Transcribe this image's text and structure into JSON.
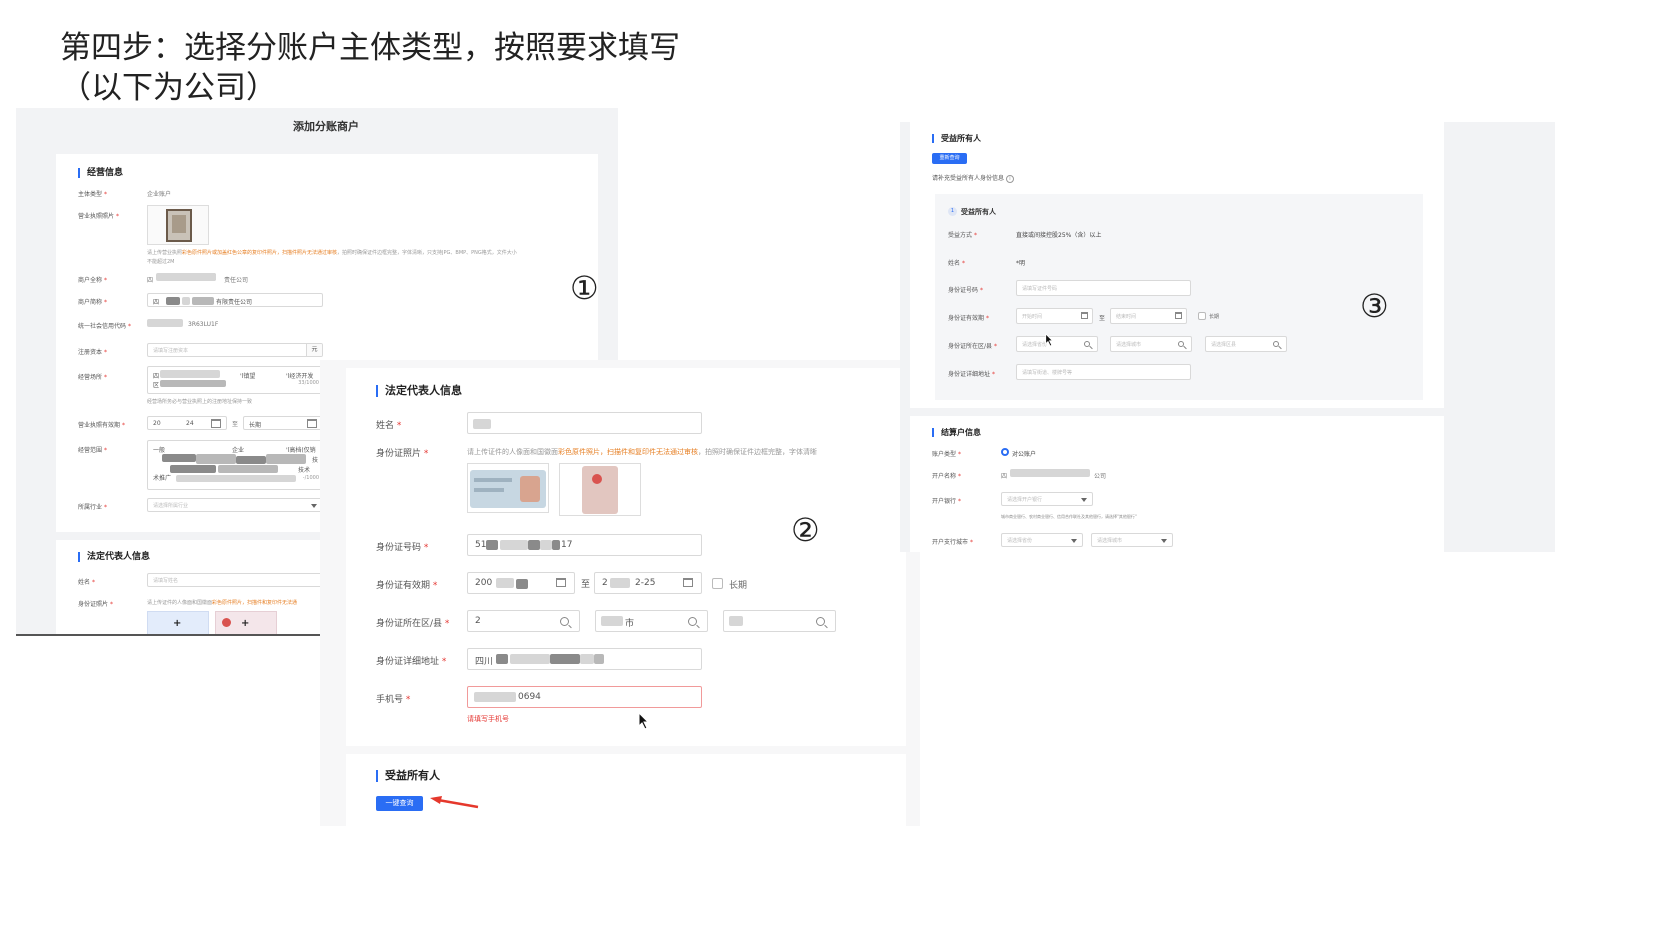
{
  "slide": {
    "title_line1": "第四步：选择分账户主体类型，按照要求填写",
    "title_line2": "（以下为公司）"
  },
  "markers": {
    "one": "①",
    "two": "②",
    "three": "③"
  },
  "panel1": {
    "header": "添加分账商户",
    "section_business": "经营信息",
    "subject_type_label": "主体类型",
    "subject_type_value": "企业账户",
    "license_photo_label": "营业执照照片",
    "license_note_a": "请上传营业执照",
    "license_note_b": "彩色原件照片或加盖红色公章的复印件照片，扫描件照片无法通过审核",
    "license_note_c": "，拍照时确保证件边框完整，字体清晰，只支持JPG、BMP、PNG格式，文件大小",
    "license_note_d": "不能超过2M",
    "full_name_label": "商户全称",
    "full_name_value_a": "四",
    "full_name_value_b": "责任公司",
    "short_name_label": "商户简称",
    "short_name_value_a": "四",
    "short_name_value_b": "有限责任公司",
    "credit_code_label": "统一社会信用代码",
    "credit_code_value": "3R63LU1F",
    "capital_label": "注册资本",
    "capital_placeholder": "请填写注册资本",
    "capital_unit": "元",
    "address_label": "经营场所",
    "address_value_a": "四",
    "address_value_b": "'l镇望",
    "address_value_c": "'l经济开发",
    "address_value_d": "区",
    "address_counter": "33/1000",
    "address_note": "经营场所务必与营业执照上的注册地址保持一致",
    "validity_label": "营业执照有效期",
    "validity_start_a": "20",
    "validity_start_b": "24",
    "validity_to": "至",
    "validity_end": "长期",
    "scope_label": "经营范围",
    "scope_line1_a": "一般",
    "scope_line1_b": "企业",
    "scope_line1_c": "'l高档(仅销",
    "scope_line3": "技",
    "scope_line4_a": "术推广",
    "scope_line4_b": "技术",
    "scope_line5": "-/1000",
    "industry_label": "所属行业",
    "industry_placeholder": "请选择所属行业",
    "section_legal": "法定代表人信息",
    "legal_name_label": "姓名",
    "legal_name_placeholder": "请填写姓名",
    "legal_id_photo_label": "身份证照片",
    "legal_id_note_a": "请上传证件的人像面和国徽面",
    "legal_id_note_b": "彩色原件照片，扫描件和复印件无法通",
    "plus_1": "+",
    "plus_2": "+"
  },
  "panel2": {
    "section_legal": "法定代表人信息",
    "name_label": "姓名",
    "id_photo_label": "身份证照片",
    "id_photo_note_a": "请上传证件的人像面和国徽面",
    "id_photo_note_b": "彩色原件照片，扫描件和复印件无法通过审核",
    "id_photo_note_c": "，拍照时确保证件边框完整，字体清晰",
    "id_number_label": "身份证号码",
    "id_number_a": "51",
    "id_number_b": "17",
    "id_validity_label": "身份证有效期",
    "id_validity_start": "200",
    "id_validity_to": "至",
    "id_validity_end_a": "2",
    "id_validity_end_b": "2-25",
    "long_term": "长期",
    "region_label": "身份证所在区/县",
    "region_1": "2",
    "region_2": "市",
    "address_label": "身份证详细地址",
    "address_value": "四川",
    "phone_label": "手机号",
    "phone_value": "0694",
    "phone_error": "请填写手机号",
    "section_beneficiary": "受益所有人",
    "query_button": "一键查询"
  },
  "panel3": {
    "section_beneficiary": "受益所有人",
    "requery_button": "重新查询",
    "supplement_note": "请补充受益所有人身份信息",
    "info_icon": "i",
    "beneficiary_index": "1",
    "beneficiary_title": "受益所有人",
    "benefit_method_label": "受益方式",
    "benefit_method_value": "直接或间接控股25%（含）以上",
    "name_label": "姓名",
    "name_value": "*明",
    "id_number_label": "身份证号码",
    "id_number_placeholder": "请填写证件号码",
    "id_validity_label": "身份证有效期",
    "start_placeholder": "开始时间",
    "to": "至",
    "end_placeholder": "结束时间",
    "long_term": "长期",
    "region_label": "身份证所在区/县",
    "province_placeholder": "请选择省份",
    "city_placeholder": "请选择城市",
    "district_placeholder": "请选择区县",
    "address_label": "身份证详细地址",
    "address_placeholder": "请填写街道、楼牌号等",
    "section_settlement": "结算户信息",
    "account_type_label": "账户类型",
    "account_type_value": "对公账户",
    "account_name_label": "开户名称",
    "account_name_a": "四",
    "account_name_b": "公司",
    "bank_label": "开户银行",
    "bank_placeholder": "请选择开户银行",
    "bank_note": "城市商业银行、农村商业银行、信用合作联社及其他银行，请选择\"其他银行\"",
    "branch_city_label": "开户支行城市",
    "branch_province_placeholder": "请选择省份",
    "branch_city_placeholder": "请选择城市"
  },
  "colors": {
    "accent": "#2a6df4",
    "required": "#e53935",
    "warning": "#e67e22",
    "arrow": "#e5382c"
  },
  "icons": [
    "calendar-icon",
    "search-icon",
    "chevron-down-icon",
    "info-icon",
    "mouse-cursor-icon",
    "red-arrow-icon"
  ]
}
